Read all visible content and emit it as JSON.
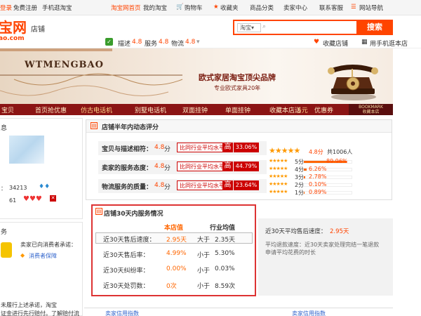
{
  "topnav": {
    "left1": "登录",
    "left2": "免费注册",
    "left3": "手机逛淘宝",
    "home": "淘宝网首页",
    "mytaobao": "我的淘宝",
    "cart": "购物车",
    "fav": "收藏夹",
    "cats": "商品分类",
    "seller": "卖家中心",
    "service": "联系客服",
    "sitenav": "网站导航"
  },
  "header": {
    "logo1": "宝网",
    "logo2": "ao.com",
    "store": "店铺",
    "search_scope": "淘宝",
    "search_button": "搜索"
  },
  "ratestrip": {
    "desc_label": "描述",
    "desc_val": "4.8",
    "serv_label": "服务",
    "serv_val": "4.8",
    "ship_label": "物流",
    "ship_val": "4.8",
    "fav_store": "收藏店铺",
    "mobile": "用手机逛本店"
  },
  "banner": {
    "name": "WTMENGBAO",
    "slogan": "欧式家居淘宝顶尖品牌",
    "sub": "专业欧式家具20年"
  },
  "storenav": {
    "i0": "宝贝",
    "i1": "首页抢优惠",
    "i2": "仿古电话机",
    "i3": "别墅电话机",
    "i4": "双面挂钟",
    "i5": "单面挂钟",
    "i6": "收藏本店送",
    "i6b": "5元",
    "i6c": "优惠券",
    "bm1": "BOOKMARK",
    "bm2": "收藏本店"
  },
  "sidebar": {
    "info": "息",
    "num1_label": "：",
    "num1": "34213",
    "num2": "61",
    "promise": "务",
    "promise_text": "卖家已向消费者承诺：",
    "guarantee": "消费者保障",
    "foot1": "未履行上述承诺，淘宝",
    "foot2": "证金进行先行赔付。了解赔付流程"
  },
  "rating": {
    "title": "店铺半年内动态评分",
    "rows": [
      {
        "label": "宝贝与描述相符：",
        "score": "4.8",
        "unit": "分",
        "cmp": "比同行业平均水平",
        "dir": "高",
        "pct": "33.06%"
      },
      {
        "label": "卖家的服务态度：",
        "score": "4.8",
        "unit": "分",
        "cmp": "比同行业平均水平",
        "dir": "高",
        "pct": "44.79%"
      },
      {
        "label": "物流服务的质量：",
        "score": "4.8",
        "unit": "分",
        "cmp": "比同行业平均水平",
        "dir": "高",
        "pct": "23.64%"
      }
    ],
    "summary_score": "4.8分",
    "summary_total": "共1006人",
    "dist": [
      {
        "label": "5分",
        "pct": "89.96%",
        "frac": 0.8996
      },
      {
        "label": "4分",
        "pct": "6.26%",
        "frac": 0.0626
      },
      {
        "label": "3分",
        "pct": "2.78%",
        "frac": 0.0278
      },
      {
        "label": "2分",
        "pct": "0.10%",
        "frac": 0.001
      },
      {
        "label": "1分",
        "pct": "0.89%",
        "frac": 0.0089
      }
    ]
  },
  "service30": {
    "title": "店铺30天内服务情况",
    "col_store": "本店值",
    "col_avg": "行业均值",
    "rows": [
      {
        "label": "近30天售后速度：",
        "store": "2.95天",
        "cmp": "大于",
        "avg": "2.35天"
      },
      {
        "label": "近30天售后率：",
        "store": "4.99%",
        "cmp": "小于",
        "avg": "5.30%"
      },
      {
        "label": "近30天纠纷率：",
        "store": "0.00%",
        "cmp": "小于",
        "avg": "0.03%"
      },
      {
        "label": "近30天处罚数：",
        "store": "0次",
        "cmp": "小于",
        "avg": "8.59次"
      }
    ],
    "side_label": "近30天平均售后速度：",
    "side_val": "2.95天",
    "side_desc1": "平均退款速度：近30天卖家处理完结一笔退款",
    "side_desc2": "申请平均花费的时长"
  },
  "bottom": {
    "b1": "卖家信用指数",
    "b2": "卖家信用指数"
  },
  "colors": {
    "accent": "#ff4400",
    "nav": "#8b1414",
    "alert": "#cc0000"
  }
}
